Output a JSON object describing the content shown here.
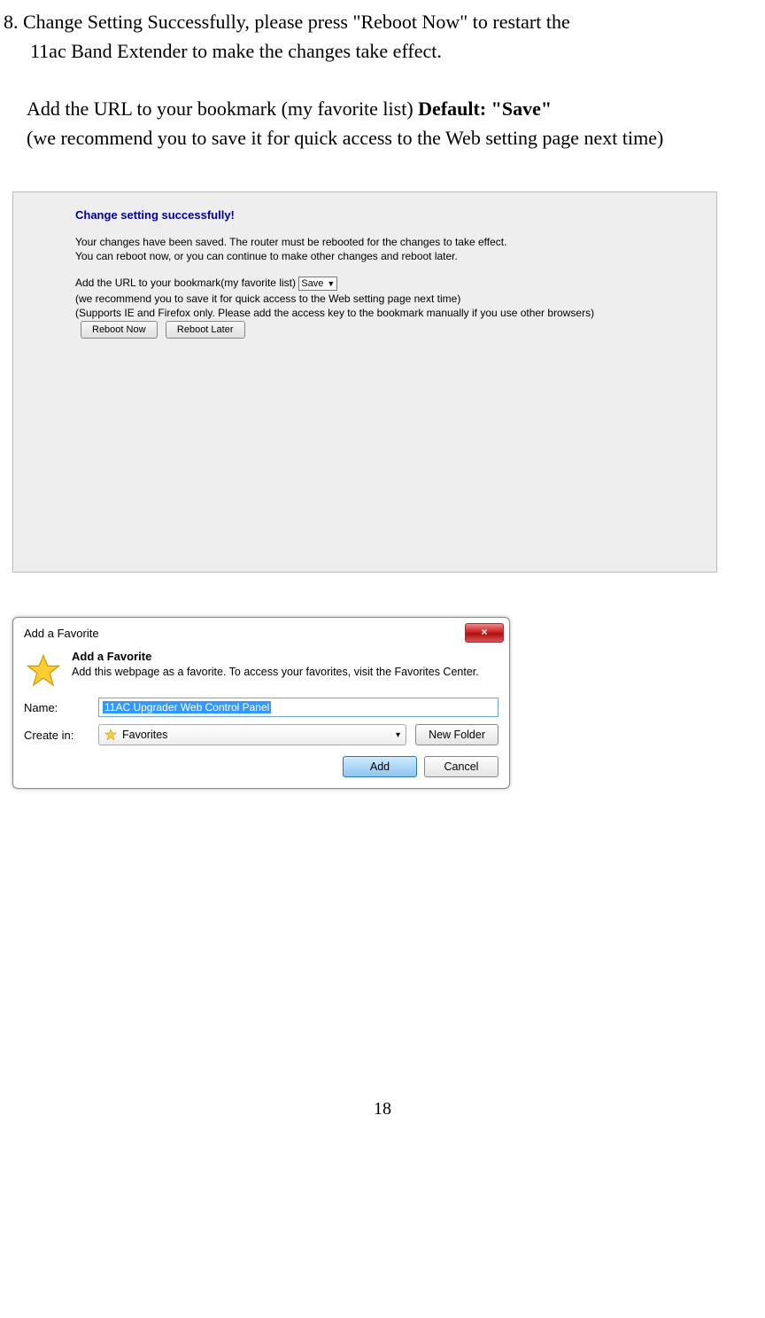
{
  "doc": {
    "step_num": "8.",
    "step_text_part1": "Change Setting Successfully, please press \"Reboot Now\" to restart the",
    "step_text_part2": "11ac Band Extender to make the changes take effect.",
    "para2_part1": "Add the URL to your bookmark (my favorite list) ",
    "para2_bold": "Default: \"Save\"",
    "para2_part2": "(we recommend you to save it for quick access to the Web setting page next time)",
    "page_number": "18"
  },
  "panel1": {
    "title": "Change setting successfully!",
    "line1": "Your changes have been saved. The router must be rebooted for the changes to take effect.",
    "line2": "You can reboot now, or you can continue to make other changes and reboot later.",
    "line3": "Add the URL to your bookmark(my favorite list)",
    "save_option": "Save",
    "line4": "(we recommend you to save it for quick access to the Web setting page next time)",
    "line5": "(Supports IE and Firefox only. Please add the access key to the bookmark manually if you use other browsers)",
    "btn_reboot_now": "Reboot Now",
    "btn_reboot_later": "Reboot Later"
  },
  "panel2": {
    "titlebar": "Add a Favorite",
    "close_x": "×",
    "heading": "Add a Favorite",
    "desc": "Add this webpage as a favorite. To access your favorites, visit the Favorites Center.",
    "name_label": "Name:",
    "name_value": "11AC Upgrader Web Control Panel",
    "createin_label": "Create in:",
    "createin_value": "Favorites",
    "createin_arrow": "▾",
    "btn_newfolder": "New Folder",
    "btn_add": "Add",
    "btn_cancel": "Cancel"
  }
}
